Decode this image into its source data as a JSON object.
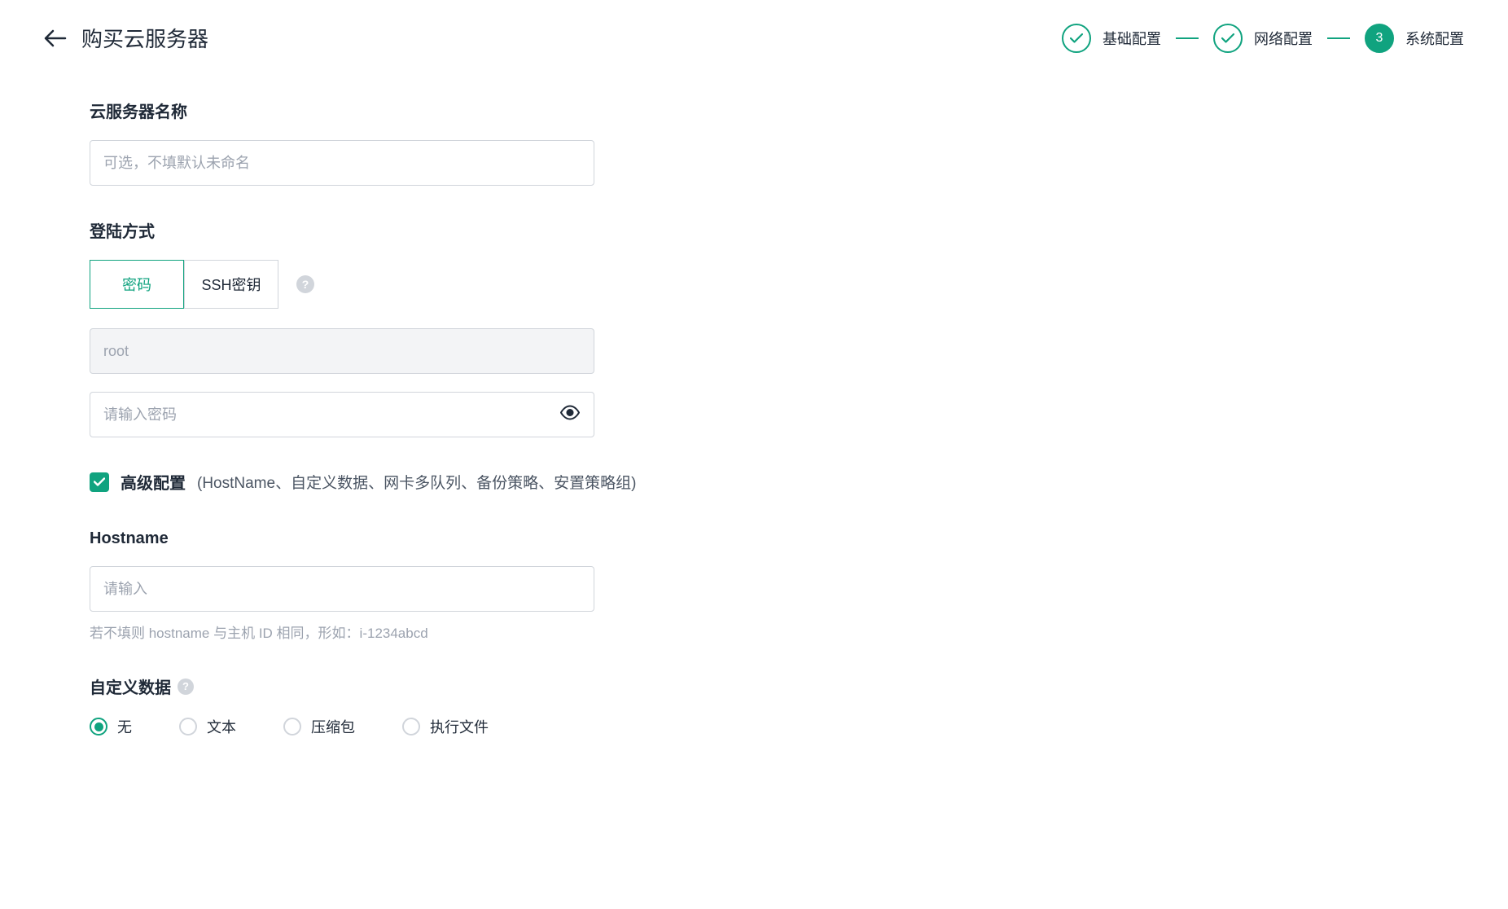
{
  "header": {
    "title": "购买云服务器",
    "steps": [
      {
        "label": "基础配置",
        "status": "done"
      },
      {
        "label": "网络配置",
        "status": "done"
      },
      {
        "label": "系统配置",
        "status": "active",
        "number": "3"
      }
    ]
  },
  "serverName": {
    "label": "云服务器名称",
    "placeholder": "可选，不填默认未命名",
    "value": ""
  },
  "loginMethod": {
    "label": "登陆方式",
    "tabs": [
      {
        "label": "密码",
        "active": true
      },
      {
        "label": "SSH密钥",
        "active": false
      }
    ],
    "username": {
      "value": "root"
    },
    "password": {
      "placeholder": "请输入密码",
      "value": ""
    }
  },
  "advanced": {
    "checkbox_label": "高级配置",
    "hint": "(HostName、自定义数据、网卡多队列、备份策略、安置策略组)",
    "checked": true
  },
  "hostname": {
    "label": "Hostname",
    "placeholder": "请输入",
    "value": "",
    "hint": "若不填则 hostname 与主机 ID 相同，形如：i-1234abcd"
  },
  "customData": {
    "label": "自定义数据",
    "options": [
      {
        "label": "无",
        "checked": true
      },
      {
        "label": "文本",
        "checked": false
      },
      {
        "label": "压缩包",
        "checked": false
      },
      {
        "label": "执行文件",
        "checked": false
      }
    ]
  },
  "helpText": "?"
}
